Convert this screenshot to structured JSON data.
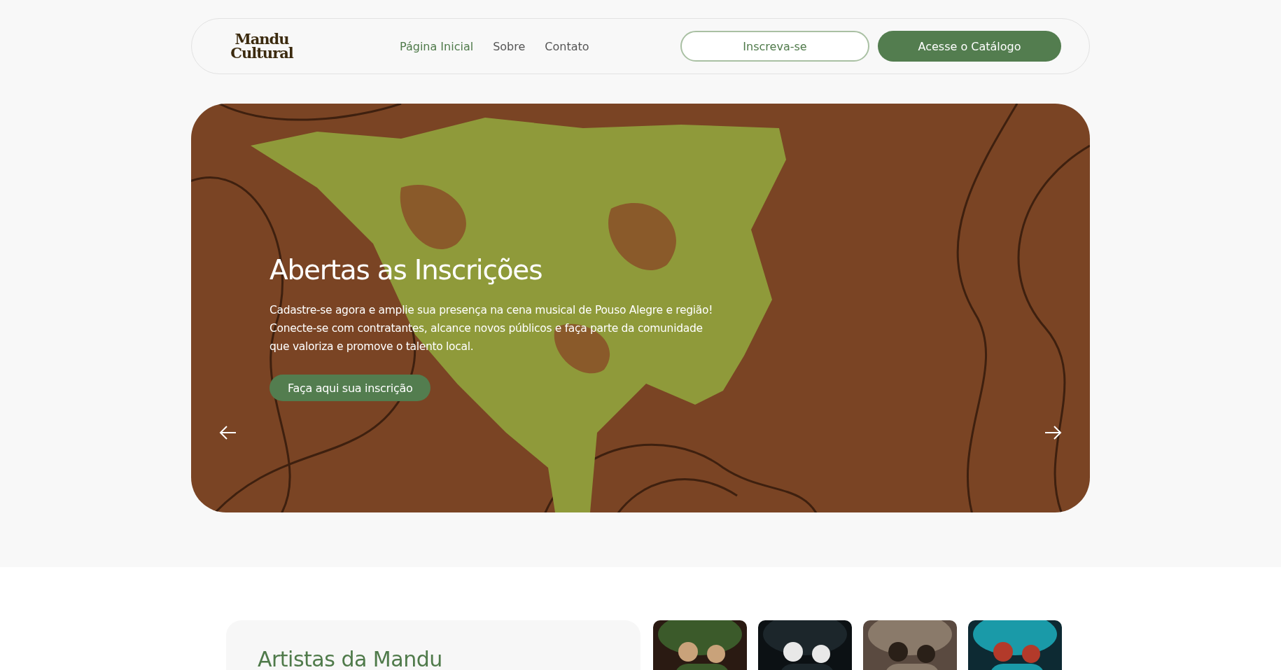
{
  "header": {
    "logo": "Mandu Cultural",
    "nav": [
      {
        "label": "Página Inicial",
        "selected": true
      },
      {
        "label": "Sobre",
        "selected": false
      },
      {
        "label": "Contato",
        "selected": false
      }
    ],
    "buttons": [
      {
        "label": "Inscreva-se",
        "kind": "outline"
      },
      {
        "label": "Acesse o Catálogo",
        "kind": "filled"
      }
    ]
  },
  "hero": {
    "title": "Abertas as Inscrições",
    "text": "Cadastre-se agora e amplie sua presença na cena musical de Pouso Alegre e região! Conecte-se com contratantes, alcance novos públicos e faça parte da comunidade que valoriza e promove o talento local.",
    "button": "Faça aqui sua inscrição"
  },
  "artists": {
    "title": "Artistas da Mandu"
  }
}
